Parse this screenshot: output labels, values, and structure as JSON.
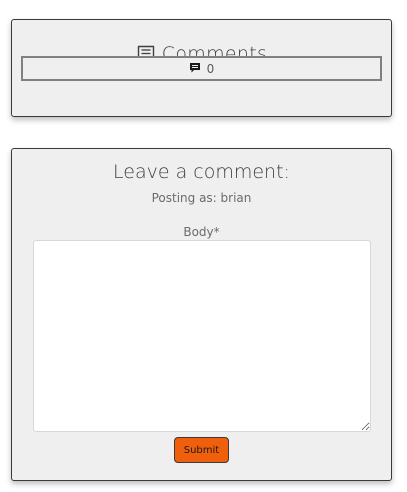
{
  "comments": {
    "title": "Comments",
    "count": "0",
    "icon": "comment-icon",
    "count_icon": "comment-filled-icon"
  },
  "comment_form": {
    "title": "Leave a comment:",
    "posting_as": "Posting as: brian",
    "body_label": "Body*",
    "body_value": "",
    "submit_label": "Submit"
  },
  "colors": {
    "card_background": "#efefef",
    "submit_button": "#f0600c"
  }
}
